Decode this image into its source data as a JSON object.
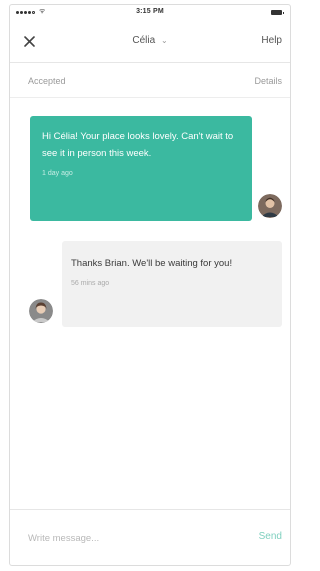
{
  "status_bar": {
    "time": "3:15 PM",
    "signal_icon": "cellular-signal-icon",
    "wifi_icon": "wifi-icon",
    "battery_icon": "battery-icon"
  },
  "header": {
    "title": "Célia",
    "close_icon": "close-icon",
    "chevron_icon": "chevron-down-icon",
    "help_label": "Help"
  },
  "reservation": {
    "status": "Accepted",
    "details_label": "Details"
  },
  "messages": [
    {
      "sender": "host",
      "text": "Hi Célia! Your place looks lovely. Can't wait to see it in person this week.",
      "timestamp": "1 day ago",
      "avatar_icon": "user-avatar"
    },
    {
      "sender": "guest",
      "text": "Thanks Brian. We'll be waiting for you!",
      "timestamp": "56 mins ago",
      "avatar_icon": "user-avatar"
    }
  ],
  "composer": {
    "placeholder": "Write message...",
    "send_label": "Send"
  },
  "colors": {
    "accent": "#3bb9a0",
    "send": "#7fd0bf",
    "incoming_bubble": "#f1f1f1",
    "muted_text": "#9a9a9a"
  }
}
